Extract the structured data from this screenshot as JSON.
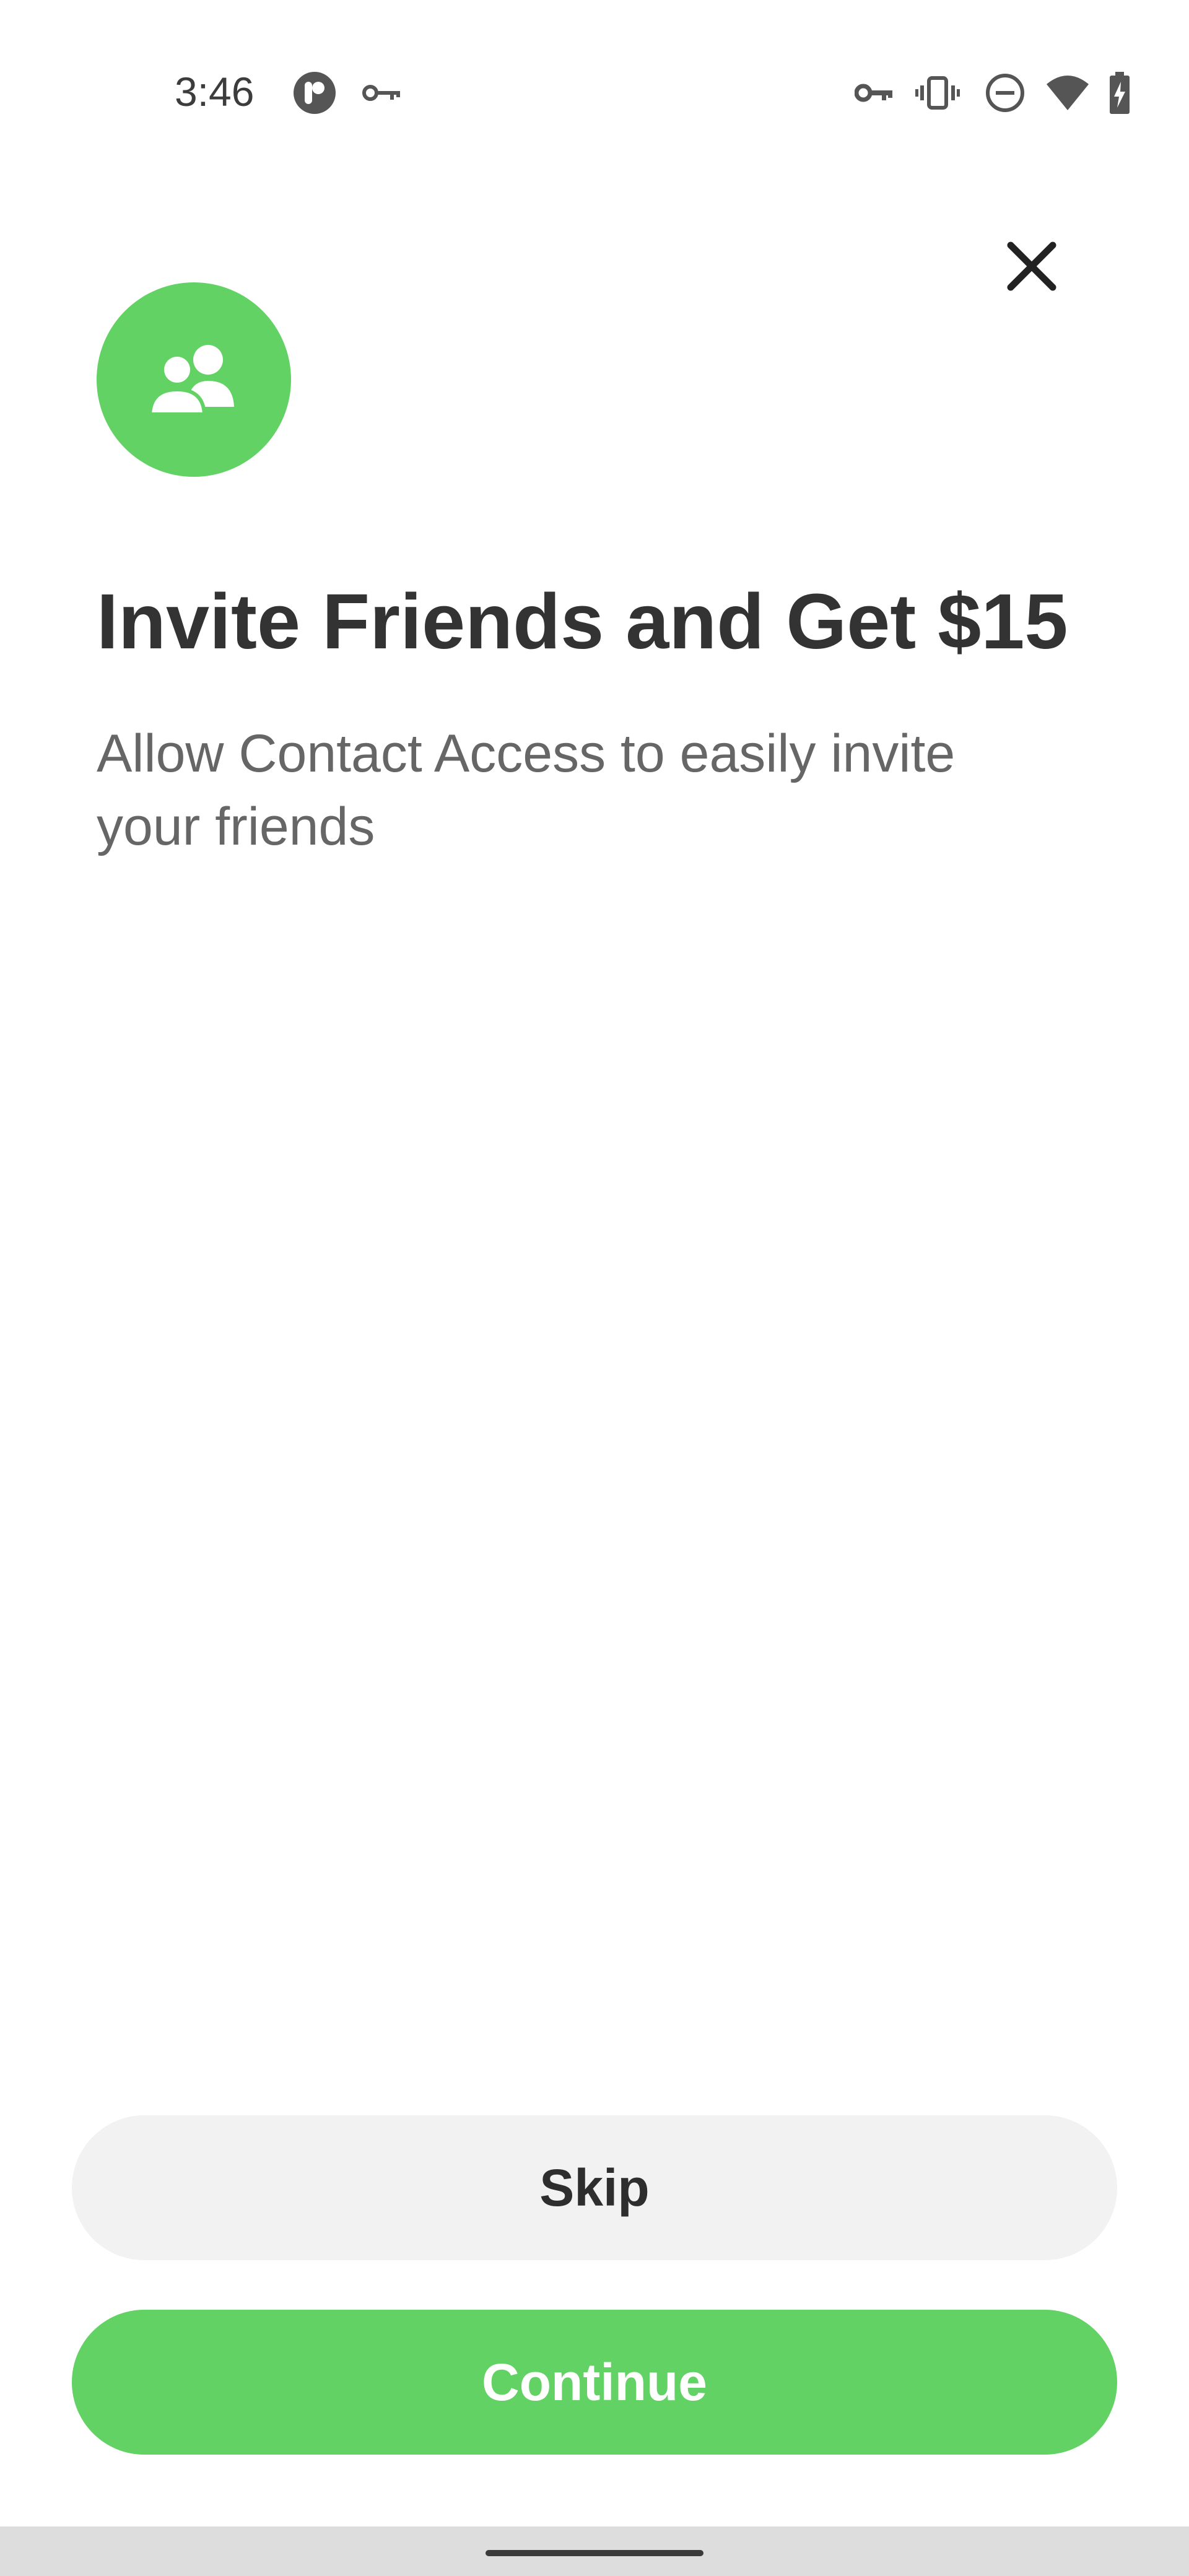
{
  "status_bar": {
    "time": "3:46",
    "left_icons": [
      "app-notification-icon",
      "vpn-key-icon"
    ],
    "right_icons": [
      "vpn-key-icon",
      "vibrate-icon",
      "do-not-disturb-icon",
      "wifi-icon",
      "battery-charging-icon"
    ]
  },
  "header": {
    "close_icon": "close-icon"
  },
  "hero": {
    "icon": "people-icon",
    "accent_color": "#61d263"
  },
  "content": {
    "title": "Invite Friends and Get $15",
    "subtitle": "Allow Contact Access to easily invite your friends"
  },
  "actions": {
    "skip_label": "Skip",
    "continue_label": "Continue"
  },
  "colors": {
    "accent": "#61d263",
    "title_text": "#333333",
    "subtitle_text": "#666666",
    "skip_bg": "#f2f2f2"
  }
}
